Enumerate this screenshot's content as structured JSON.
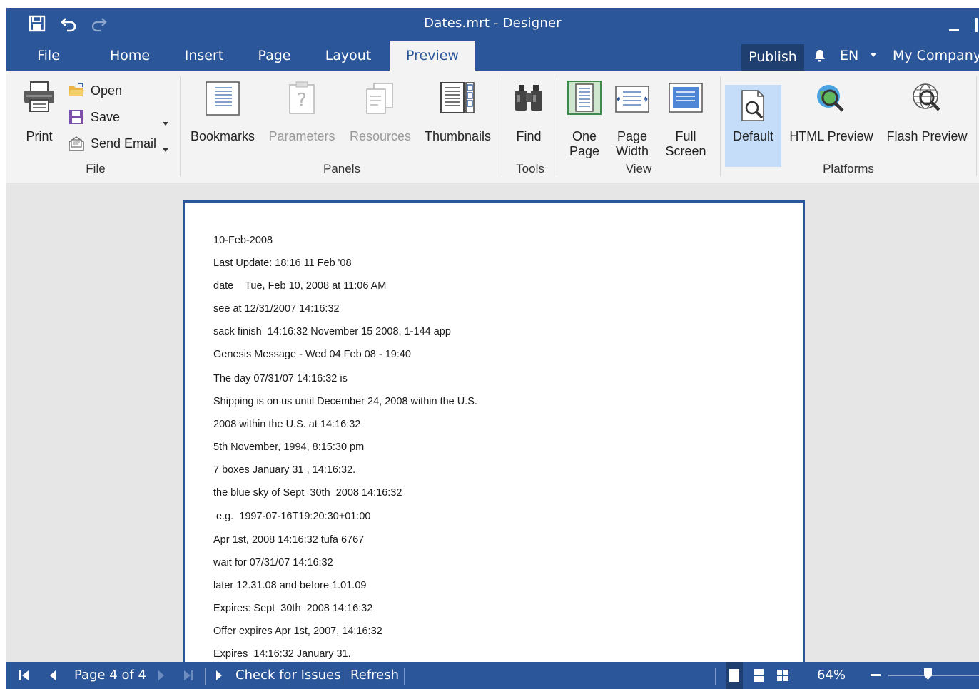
{
  "window": {
    "title": "Dates.mrt - Designer"
  },
  "quick_access": {
    "icons": [
      "save-icon",
      "undo-icon",
      "redo-icon"
    ]
  },
  "tabs": [
    {
      "label": "File",
      "active": false
    },
    {
      "label": "Home",
      "active": false
    },
    {
      "label": "Insert",
      "active": false
    },
    {
      "label": "Page",
      "active": false
    },
    {
      "label": "Layout",
      "active": false
    },
    {
      "label": "Preview",
      "active": true
    }
  ],
  "header_right": {
    "publish": "Publish",
    "language": "EN",
    "company": "My Company"
  },
  "ribbon": {
    "file_group": {
      "label": "File",
      "print": "Print",
      "open": "Open",
      "save": "Save",
      "send_email": "Send Email"
    },
    "panels_group": {
      "label": "Panels",
      "bookmarks": "Bookmarks",
      "parameters": "Parameters",
      "resources": "Resources",
      "thumbnails": "Thumbnails"
    },
    "tools_group": {
      "label": "Tools",
      "find": "Find"
    },
    "view_group": {
      "label": "View",
      "one_page_1": "One",
      "one_page_2": "Page",
      "page_width_1": "Page",
      "page_width_2": "Width",
      "full_screen_1": "Full",
      "full_screen_2": "Screen"
    },
    "platforms_group": {
      "label": "Platforms",
      "default": "Default",
      "html_preview": "HTML Preview",
      "flash_preview": "Flash Preview"
    }
  },
  "document": {
    "lines": [
      "10-Feb-2008",
      "Last Update: 18:16 11 Feb '08",
      "date    Tue, Feb 10, 2008 at 11:06 AM",
      "see at 12/31/2007 14:16:32",
      "sack finish  14:16:32 November 15 2008, 1-144 app",
      "Genesis Message - Wed 04 Feb 08 - 19:40",
      "The day 07/31/07 14:16:32 is",
      "Shipping is on us until December 24, 2008 within the U.S.",
      "2008 within the U.S. at 14:16:32",
      "5th November, 1994, 8:15:30 pm",
      "7 boxes January 31 , 14:16:32.",
      "the blue sky of Sept  30th  2008 14:16:32",
      " e.g.  1997-07-16T19:20:30+01:00",
      "Apr 1st, 2008 14:16:32 tufa 6767",
      "wait for 07/31/07 14:16:32",
      "later 12.31.08 and before 1.01.09",
      "Expires: Sept  30th  2008 14:16:32",
      "Offer expires Apr 1st, 2007, 14:16:32",
      "Expires  14:16:32 January 31."
    ]
  },
  "statusbar": {
    "page_info": "Page 4 of 4",
    "check_issues": "Check for Issues",
    "refresh": "Refresh",
    "zoom": "64%",
    "zoom_level": 0.64
  },
  "colors": {
    "accent": "#2b579a",
    "ribbon_bg": "#f3f3f3",
    "selected_bg": "#c5ddf8",
    "workspace_bg": "#e6e6e6"
  }
}
